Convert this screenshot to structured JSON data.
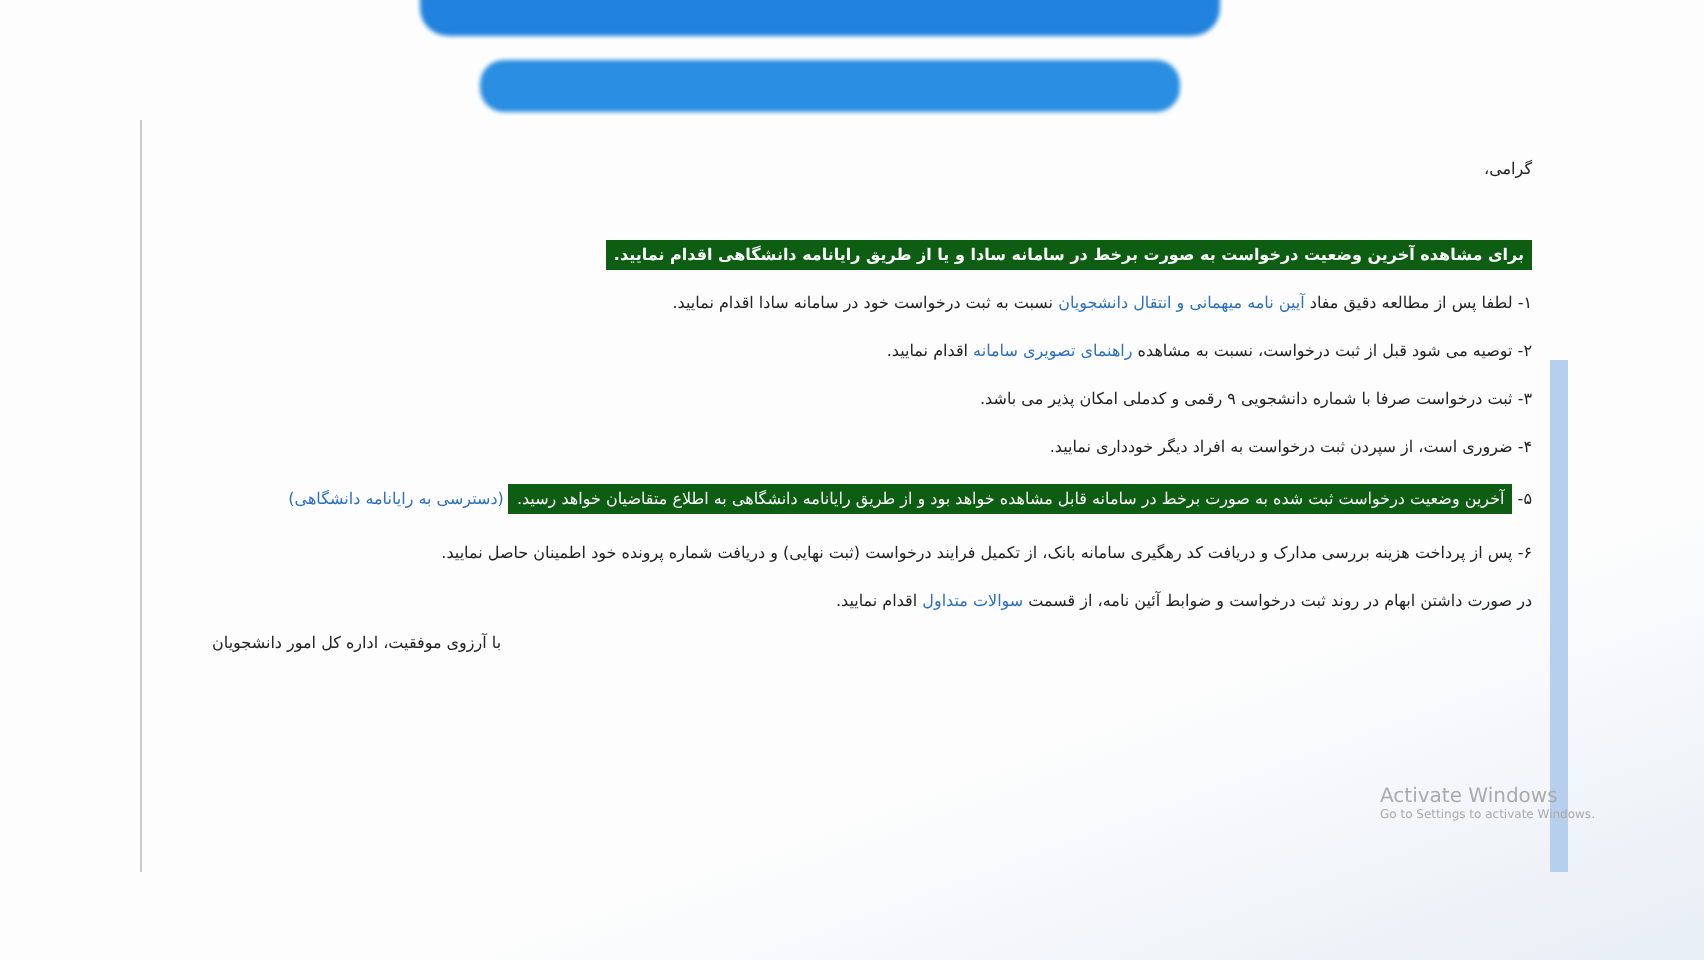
{
  "greeting": "گرامی،",
  "heading": "برای مشاهده آخرین وضعیت درخواست به صورت برخط در سامانه سادا و یا از طریق رایانامه دانشگاهی اقدام نمایید.",
  "items": [
    {
      "segments": [
        {
          "kind": "text",
          "text": "۱- لطفا پس از مطالعه دقیق مفاد "
        },
        {
          "kind": "link",
          "text": "آیین نامه میهمانی و انتقال دانشجویان"
        },
        {
          "kind": "text",
          "text": " نسبت به ثبت درخواست خود در سامانه سادا اقدام نمایید."
        }
      ]
    },
    {
      "segments": [
        {
          "kind": "text",
          "text": "۲- توصیه می شود قبل از ثبت درخواست، نسبت به مشاهده "
        },
        {
          "kind": "link",
          "text": "راهنمای تصویری سامانه"
        },
        {
          "kind": "text",
          "text": " اقدام نمایید."
        }
      ]
    },
    {
      "segments": [
        {
          "kind": "text",
          "text": "۳- ثبت درخواست صرفا با شماره دانشجویی ۹ رقمی و کدملی امکان پذیر می باشد."
        }
      ]
    },
    {
      "segments": [
        {
          "kind": "text",
          "text": "۴- ضروری است، از سپردن ثبت درخواست به افراد دیگر خودداری نمایید."
        }
      ]
    },
    {
      "segments": [
        {
          "kind": "text",
          "text": "۵- "
        },
        {
          "kind": "highlight",
          "text": "آخرین وضعیت درخواست ثبت شده به صورت برخط در سامانه قابل مشاهده خواهد بود و از طریق رایانامه دانشگاهی به اطلاع متقاضیان خواهد رسید."
        },
        {
          "kind": "link",
          "text": " (دسترسی به رایانامه دانشگاهی)"
        }
      ]
    },
    {
      "segments": [
        {
          "kind": "text",
          "text": "۶- پس از پرداخت هزینه بررسی مدارک و دریافت کد رهگیری سامانه بانک، از تکمیل فرایند درخواست (ثبت نهایی) و دریافت شماره پرونده خود اطمینان حاصل نمایید."
        }
      ]
    },
    {
      "segments": [
        {
          "kind": "text",
          "text": "در صورت داشتن ابهام در روند ثبت درخواست و ضوابط آئین نامه، از قسمت "
        },
        {
          "kind": "link",
          "text": "سوالات متداول"
        },
        {
          "kind": "text",
          "text": " اقدام نمایید."
        }
      ]
    }
  ],
  "signature": "با آرزوی موفقیت، اداره کل امور دانشجویان",
  "activation": {
    "title": "Activate Windows",
    "hint": "Go to Settings to activate Windows."
  }
}
